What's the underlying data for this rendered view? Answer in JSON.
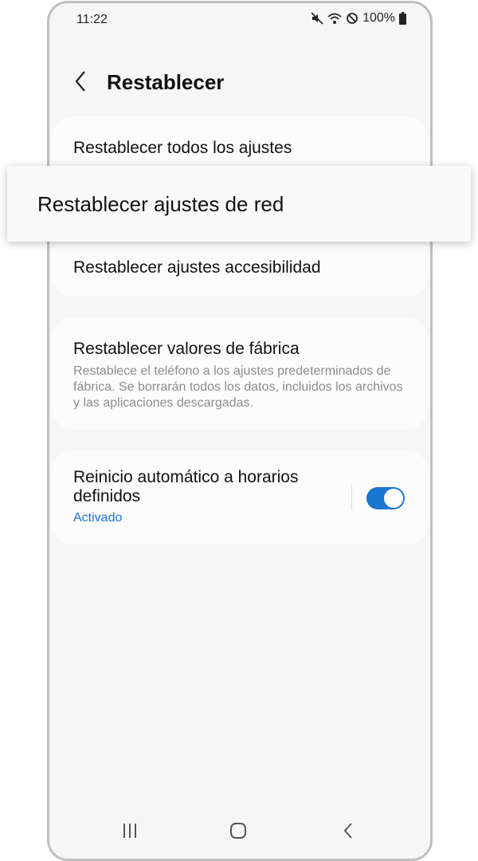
{
  "status_bar": {
    "time": "11:22",
    "battery": "100%",
    "icons": [
      "mute-icon",
      "wifi-icon",
      "do-not-disturb-icon",
      "battery-icon"
    ]
  },
  "header": {
    "title": "Restablecer"
  },
  "settings": {
    "reset_all": "Restablecer todos los ajustes",
    "reset_network": "Restablecer ajustes de red",
    "reset_accessibility": "Restablecer ajustes accesibilidad",
    "factory_reset": {
      "title": "Restablecer valores de fábrica",
      "description": "Restablece el teléfono a los ajustes predeterminados de fábrica. Se borrarán todos los datos, incluidos los archivos y las aplicaciones descargadas."
    },
    "auto_restart": {
      "title": "Reinicio automático a horarios definidos",
      "status": "Activado",
      "enabled": true
    }
  },
  "colors": {
    "accent": "#1976d2",
    "link": "#1a73d6",
    "background": "#f6f6f6",
    "card": "#fcfcfc"
  },
  "navbar": {
    "icons": [
      "recent-apps-icon",
      "home-icon",
      "back-nav-icon"
    ]
  }
}
